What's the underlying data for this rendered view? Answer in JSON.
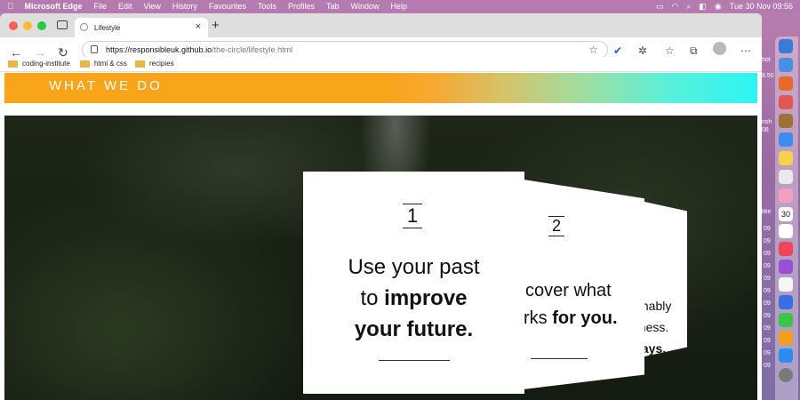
{
  "menubar": {
    "app_name": "Microsoft Edge",
    "items": [
      "File",
      "Edit",
      "View",
      "History",
      "Favourites",
      "Tools",
      "Profiles",
      "Tab",
      "Window",
      "Help"
    ],
    "clock": "Tue 30 Nov  09:56"
  },
  "browser": {
    "tab_title": "Lifestyle",
    "url_base": "https://responsibleuk.github.io",
    "url_path": "/the-circle/lifestyle.html",
    "bookmarks": [
      "coding-institute",
      "html & css",
      "recipies"
    ]
  },
  "page": {
    "banner_title": "WHAT WE DO",
    "cards": [
      {
        "number": "1",
        "line1": "Use your past",
        "line2_plain": "to ",
        "line2_bold": "improve",
        "line3_bold": "your future."
      },
      {
        "number": "2",
        "line1": "cover what",
        "line2_plain": "rks ",
        "line2_bold": "for you."
      },
      {
        "line1": "ainably",
        "line2": "dness.",
        "line3_bold": "ways."
      }
    ]
  },
  "side": {
    "dock_numbers": [
      "30",
      "09",
      "09",
      "09",
      "09",
      "09",
      "09",
      "09",
      "09",
      "09",
      "09",
      "09",
      "09"
    ],
    "side_labels": [
      "hot",
      "8.50",
      "nsh",
      "08",
      "lifie"
    ]
  },
  "colors": {
    "banner_start": "#f9a51a",
    "banner_end": "#2cf5f5",
    "desktop": "#b97fb0"
  }
}
